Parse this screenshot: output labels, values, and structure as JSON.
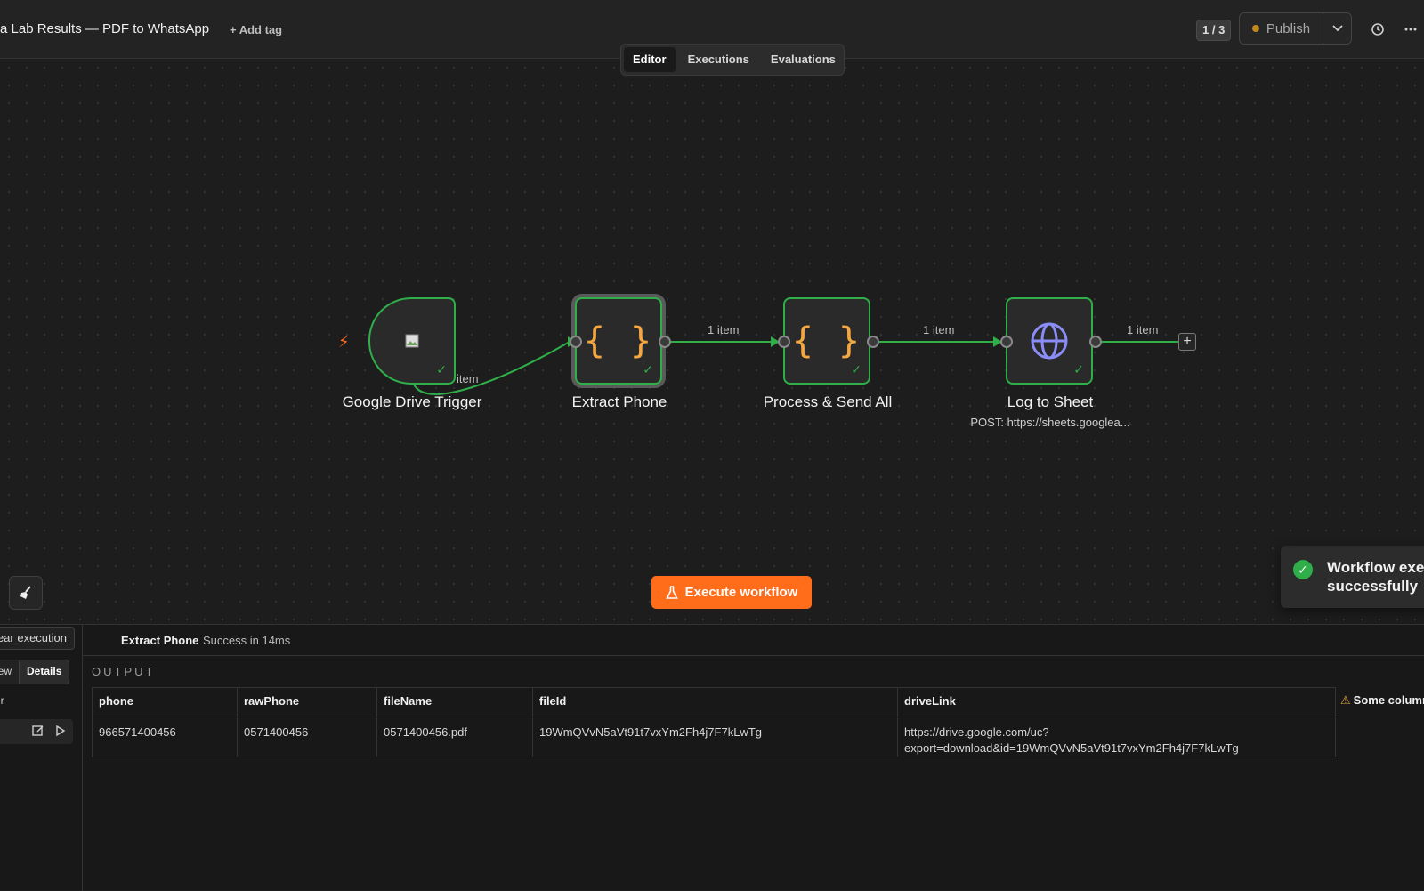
{
  "header": {
    "title": "a Lab Results — PDF to WhatsApp",
    "add_tag": "+ Add tag",
    "version_badge": "1 / 3",
    "publish_label": "Publish",
    "publish_status_color": "#c08a1e"
  },
  "tabs": [
    {
      "label": "Editor",
      "active": true
    },
    {
      "label": "Executions",
      "active": false
    },
    {
      "label": "Evaluations",
      "active": false
    }
  ],
  "nodes": [
    {
      "label": "Google Drive Trigger",
      "icon": "google-drive-image-icon",
      "status": "success"
    },
    {
      "label": "Extract Phone",
      "icon": "code-braces-icon",
      "status": "success",
      "selected": true
    },
    {
      "label": "Process & Send All",
      "icon": "code-braces-icon",
      "status": "success"
    },
    {
      "label": "Log to Sheet",
      "sublabel": "POST: https://sheets.googlea...",
      "icon": "globe-icon",
      "status": "success"
    }
  ],
  "edges": [
    {
      "label": "item"
    },
    {
      "label": "1 item"
    },
    {
      "label": "1 item"
    },
    {
      "label": "1 item"
    }
  ],
  "canvas": {
    "execute_button": "Execute workflow",
    "toast_text": "Workflow exe successfully",
    "toast_line1": "Workflow exe",
    "toast_line2": "successfully"
  },
  "panel": {
    "clear_execution": "ear execution",
    "view_tab": "view",
    "details_tab": "Details",
    "left_row_label": "er",
    "run_node": "Extract Phone",
    "run_status": "Success in 14ms",
    "output_label": "OUTPUT",
    "warning": "Some column",
    "table": {
      "columns": [
        "phone",
        "rawPhone",
        "fileName",
        "fileId",
        "driveLink"
      ],
      "rows": [
        [
          "966571400456",
          "0571400456",
          "0571400456.pdf",
          "19WmQVvN5aVt91t7vxYm2Fh4j7F7kLwTg",
          "https://drive.google.com/uc?export=download&id=19WmQVvN5aVt91t7vxYm2Fh4j7F7kLwTg"
        ]
      ],
      "drive_link_line1": "https://drive.google.com/uc?",
      "drive_link_line2": "export=download&id=19WmQVvN5aVt91t7vxYm2Fh4j7F7kLwTg"
    }
  },
  "colors": {
    "success": "#2fae4a",
    "accent": "#ff6d1b",
    "code_icon": "#f5a742",
    "globe_icon": "#8b8df7"
  }
}
